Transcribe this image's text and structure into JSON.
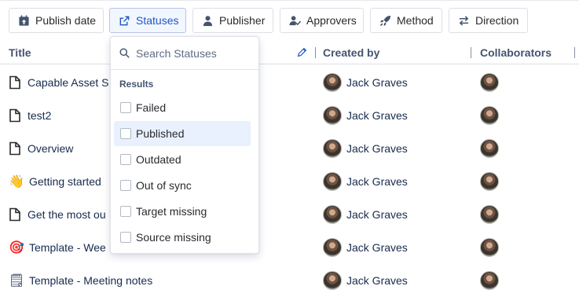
{
  "filters": [
    {
      "label": "Publish date",
      "icon": "calendar-upload-icon"
    },
    {
      "label": "Statuses",
      "icon": "share-status-icon"
    },
    {
      "label": "Publisher",
      "icon": "person-icon"
    },
    {
      "label": "Approvers",
      "icon": "person-check-icon"
    },
    {
      "label": "Method",
      "icon": "rocket-icon"
    },
    {
      "label": "Direction",
      "icon": "swap-arrows-icon"
    }
  ],
  "columns": {
    "title": "Title",
    "created_by": "Created by",
    "collaborators": "Collaborators"
  },
  "rows": [
    {
      "title": "Capable Asset S",
      "icon": "page-icon",
      "creator": "Jack Graves"
    },
    {
      "title": "test2",
      "icon": "page-icon",
      "creator": "Jack Graves"
    },
    {
      "title": "Overview",
      "icon": "page-icon",
      "creator": "Jack Graves"
    },
    {
      "title": "Getting started",
      "icon": "wave-emoji",
      "emoji": "👋",
      "creator": "Jack Graves"
    },
    {
      "title": "Get the most ou",
      "icon": "page-icon",
      "creator": "Jack Graves"
    },
    {
      "title": "Template - Wee",
      "icon": "target-emoji",
      "emoji": "🎯",
      "creator": "Jack Graves"
    },
    {
      "title": "Template - Meeting notes",
      "icon": "notepad-emoji",
      "emoji": "🗒",
      "creator": "Jack Graves"
    }
  ],
  "dropdown": {
    "search_placeholder": "Search Statuses",
    "results_label": "Results",
    "options": [
      "Failed",
      "Published",
      "Outdated",
      "Out of sync",
      "Target missing",
      "Source missing"
    ]
  },
  "colors": {
    "accent": "#1f57c3",
    "hover": "#e9f0fe",
    "border": "#dcdfe4"
  }
}
